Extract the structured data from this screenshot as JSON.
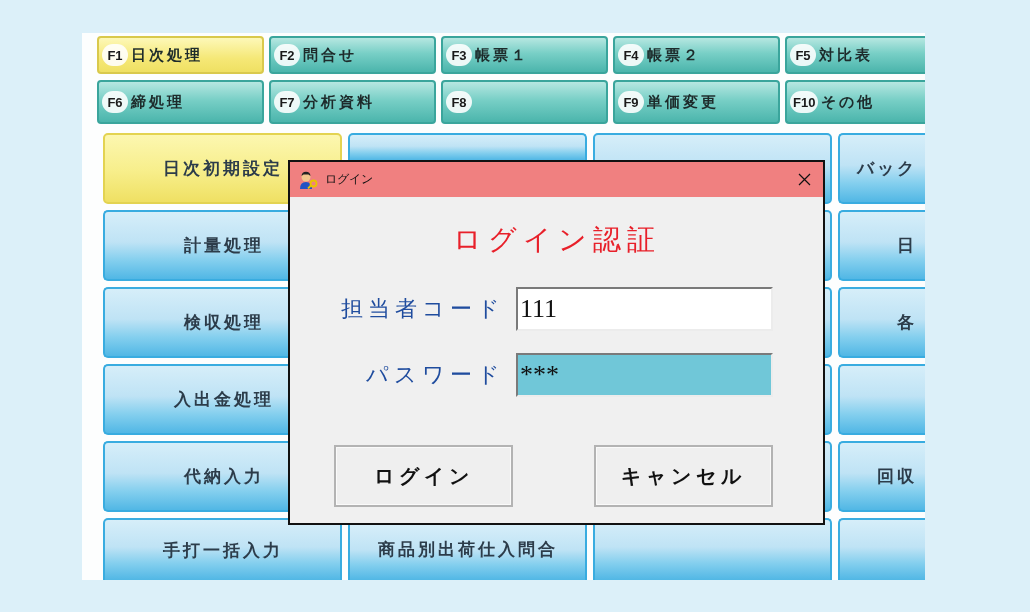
{
  "function_keys": [
    {
      "key": "F1",
      "label": "日次処理",
      "selected": true
    },
    {
      "key": "F2",
      "label": "問合せ",
      "selected": false
    },
    {
      "key": "F3",
      "label": "帳票１",
      "selected": false
    },
    {
      "key": "F4",
      "label": "帳票２",
      "selected": false
    },
    {
      "key": "F5",
      "label": "対比表",
      "selected": false
    },
    {
      "key": "F6",
      "label": "締処理",
      "selected": false
    },
    {
      "key": "F7",
      "label": "分析資料",
      "selected": false
    },
    {
      "key": "F8",
      "selected": false
    },
    {
      "key": "F9",
      "label": "単価変更",
      "selected": false
    },
    {
      "key": "F10",
      "label": "その他",
      "selected": false
    }
  ],
  "menu": {
    "rows": [
      [
        {
          "label": "日次初期設定",
          "selected": true
        },
        {
          "selected": false
        },
        {
          "selected": false
        },
        {
          "label": "バック",
          "selected": false
        }
      ],
      [
        {
          "label": "計量処理",
          "selected": false
        },
        null,
        {
          "selected": false
        },
        {
          "label": "日",
          "selected": false
        }
      ],
      [
        {
          "label": "検収処理",
          "selected": false
        },
        null,
        {
          "selected": false
        },
        {
          "label": "各",
          "selected": false
        }
      ],
      [
        {
          "label": "入出金処理",
          "selected": false
        },
        null,
        {
          "selected": false
        },
        {
          "selected": false
        }
      ],
      [
        {
          "label": "代納入力",
          "selected": false
        },
        null,
        {
          "selected": false
        },
        {
          "label": "回収",
          "selected": false
        }
      ],
      [
        {
          "label": "手打一括入力",
          "selected": false
        },
        {
          "label": "商品別出荷仕入問合",
          "selected": false
        },
        {
          "selected": false
        },
        {
          "selected": false
        }
      ]
    ]
  },
  "login_dialog": {
    "title": "ログイン",
    "heading": "ログイン認証",
    "fields": [
      {
        "label": "担当者コード",
        "value": "111",
        "focused": false
      },
      {
        "label": "パスワード",
        "value": "***",
        "focused": true
      }
    ],
    "buttons": [
      {
        "label": "ログイン"
      },
      {
        "label": "キャンセル"
      }
    ]
  }
}
